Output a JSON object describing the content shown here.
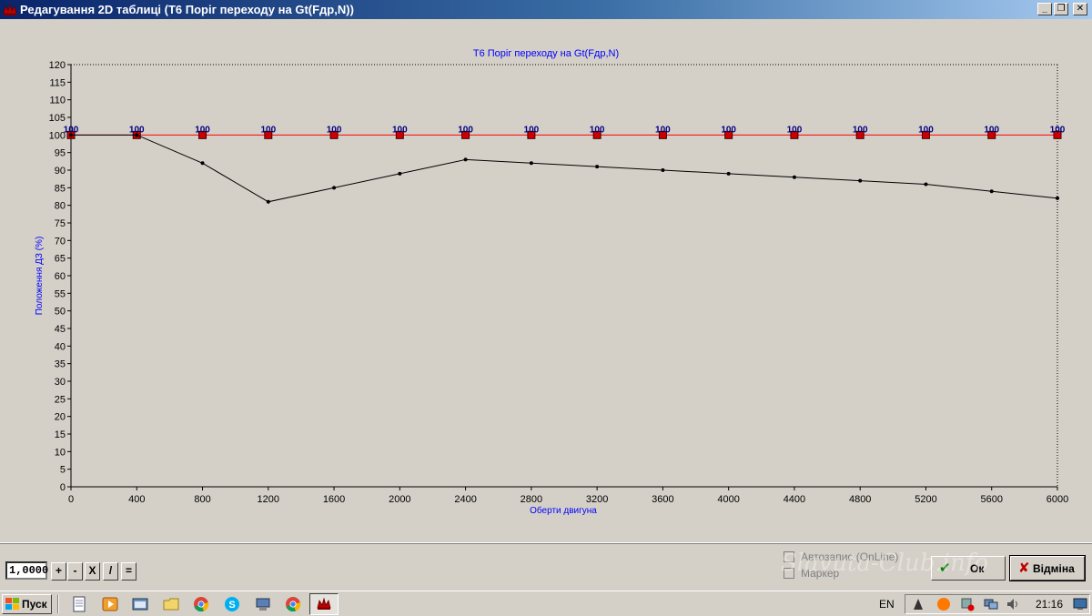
{
  "window": {
    "title": "Редагування 2D таблиці (Т6 Поріг переходу на Gt(Fдр,N))",
    "min_glyph": "_",
    "max_glyph": "❐",
    "close_glyph": "✕"
  },
  "chart_data": {
    "type": "line",
    "title": "Т6 Поріг переходу на Gt(Fдр,N)",
    "xlabel": "Оберти двигуна",
    "ylabel": "Положення ДЗ (%)",
    "x": [
      0,
      400,
      800,
      1200,
      1600,
      2000,
      2400,
      2800,
      3200,
      3600,
      4000,
      4400,
      4800,
      5200,
      5600,
      6000
    ],
    "xlim": [
      0,
      6000
    ],
    "ylim": [
      0,
      120
    ],
    "ytick_step": 5,
    "grid": false,
    "series": [
      {
        "name": "",
        "color": "#ff0000",
        "marker": "square",
        "marker_color": "#cc0000",
        "show_values": true,
        "values": [
          100,
          100,
          100,
          100,
          100,
          100,
          100,
          100,
          100,
          100,
          100,
          100,
          100,
          100,
          100,
          100
        ]
      },
      {
        "name": "",
        "color": "#000000",
        "marker": "dot",
        "show_values": false,
        "values": [
          100,
          100,
          92,
          81,
          85,
          89,
          93,
          92,
          91,
          90,
          89,
          88,
          87,
          86,
          84,
          82
        ]
      }
    ]
  },
  "panel": {
    "factor_value": "1,0000",
    "ops": [
      "+",
      "-",
      "X",
      "/",
      "="
    ],
    "autosave_label": "Автозапис (OnLine)",
    "marker_label": "Маркер",
    "ok_label": "Ок",
    "cancel_label": "Відміна",
    "watermark": "Slavuta-Club.info"
  },
  "taskbar": {
    "start_label": "Пуск",
    "language": "EN",
    "clock": "21:16"
  }
}
